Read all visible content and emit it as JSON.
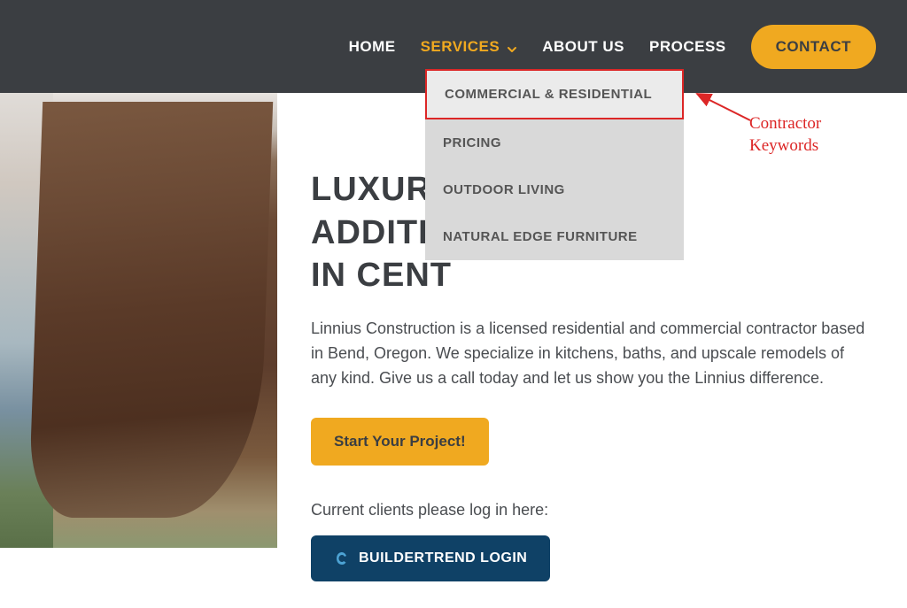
{
  "nav": {
    "home": "HOME",
    "services": "SERVICES",
    "about": "ABOUT US",
    "process": "PROCESS",
    "contact": "CONTACT"
  },
  "dropdown": {
    "items": [
      "COMMERCIAL & RESIDENTIAL",
      "PRICING",
      "OUTDOOR LIVING",
      "NATURAL EDGE FURNITURE"
    ]
  },
  "main": {
    "heading_line1": "LUXURY",
    "heading_line2": "ADDITIONS",
    "heading_line3": "IN CENT",
    "paragraph": "Linnius Construction is a licensed residential and commercial contractor based in Bend, Oregon. We specialize in kitchens, baths, and upscale remodels of any kind. Give us a call today and let us show you the Linnius difference.",
    "cta_label": "Start Your Project!",
    "login_prompt": "Current clients please log in here:",
    "login_label": "BUILDERTREND LOGIN"
  },
  "annotation": {
    "line1": "Contractor",
    "line2": "Keywords"
  }
}
